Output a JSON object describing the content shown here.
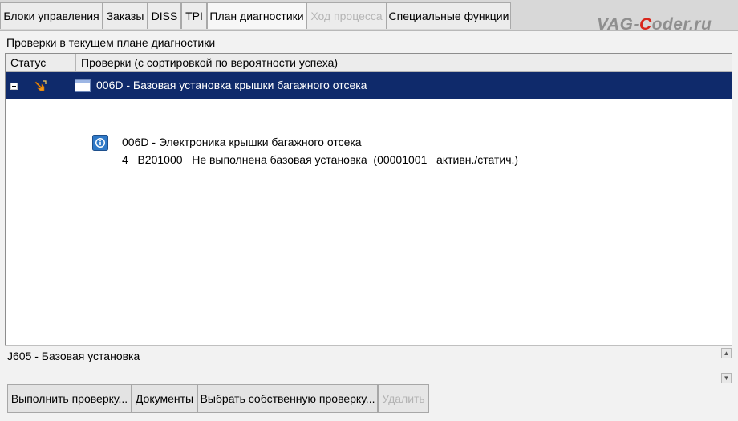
{
  "tabs": [
    {
      "label": "Блоки управления",
      "state": "normal"
    },
    {
      "label": "Заказы",
      "state": "normal"
    },
    {
      "label": "DISS",
      "state": "normal"
    },
    {
      "label": "TPI",
      "state": "normal"
    },
    {
      "label": "План диагностики",
      "state": "active"
    },
    {
      "label": "Ход процесса",
      "state": "disabled"
    },
    {
      "label": "Специальные функции",
      "state": "normal"
    }
  ],
  "watermark": {
    "pre": "VAG-",
    "accent": "C",
    "post": "oder.ru"
  },
  "section_title": "Проверки в текущем плане диагностики",
  "grid": {
    "columns": {
      "status": "Статус",
      "checks": "Проверки (с сортировкой по вероятности успеха)"
    },
    "selected_row": {
      "text": "006D - Базовая установка крышки багажного отсека",
      "status_icon": "arrow-warning-icon"
    },
    "detail": {
      "title": "006D - Электроника крышки багажного отсека",
      "line": {
        "count": "4",
        "code": "B201000",
        "description": "Не выполнена базовая установка",
        "status": "(00001001   активн./статич.)"
      }
    }
  },
  "status_text": "J605 - Базовая установка",
  "buttons": [
    {
      "label": "Выполнить проверку...",
      "enabled": true
    },
    {
      "label": "Документы",
      "enabled": true
    },
    {
      "label": "Выбрать собственную проверку...",
      "enabled": true
    },
    {
      "label": "Удалить",
      "enabled": false
    }
  ],
  "colors": {
    "selection": "#0f2a6b",
    "watermark_accent": "#d9261c"
  }
}
